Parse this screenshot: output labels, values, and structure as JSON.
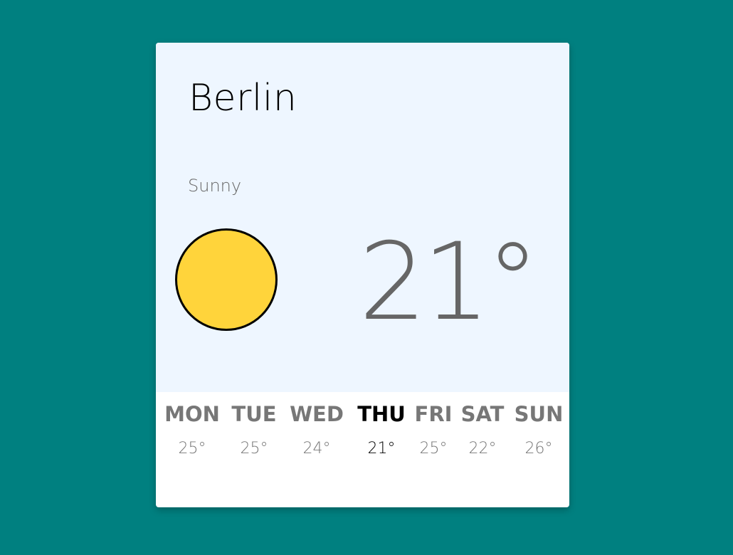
{
  "weather": {
    "city": "Berlin",
    "condition": "Sunny",
    "icon": "sun-icon",
    "temperature": "21°"
  },
  "forecast": [
    {
      "day": "MON",
      "temp": "25°"
    },
    {
      "day": "TUE",
      "temp": "25°"
    },
    {
      "day": "WED",
      "temp": "24°"
    },
    {
      "day": "THU",
      "temp": "21°",
      "active": true
    },
    {
      "day": "FRI",
      "temp": "25°"
    },
    {
      "day": "SAT",
      "temp": "22°"
    },
    {
      "day": "SUN",
      "temp": "26°"
    }
  ],
  "colors": {
    "background": "#008080",
    "card": "#ffffff",
    "card_top": "#eef6ff",
    "sun": "#ffd43b",
    "muted_text": "#777777",
    "active_text": "#000000"
  }
}
